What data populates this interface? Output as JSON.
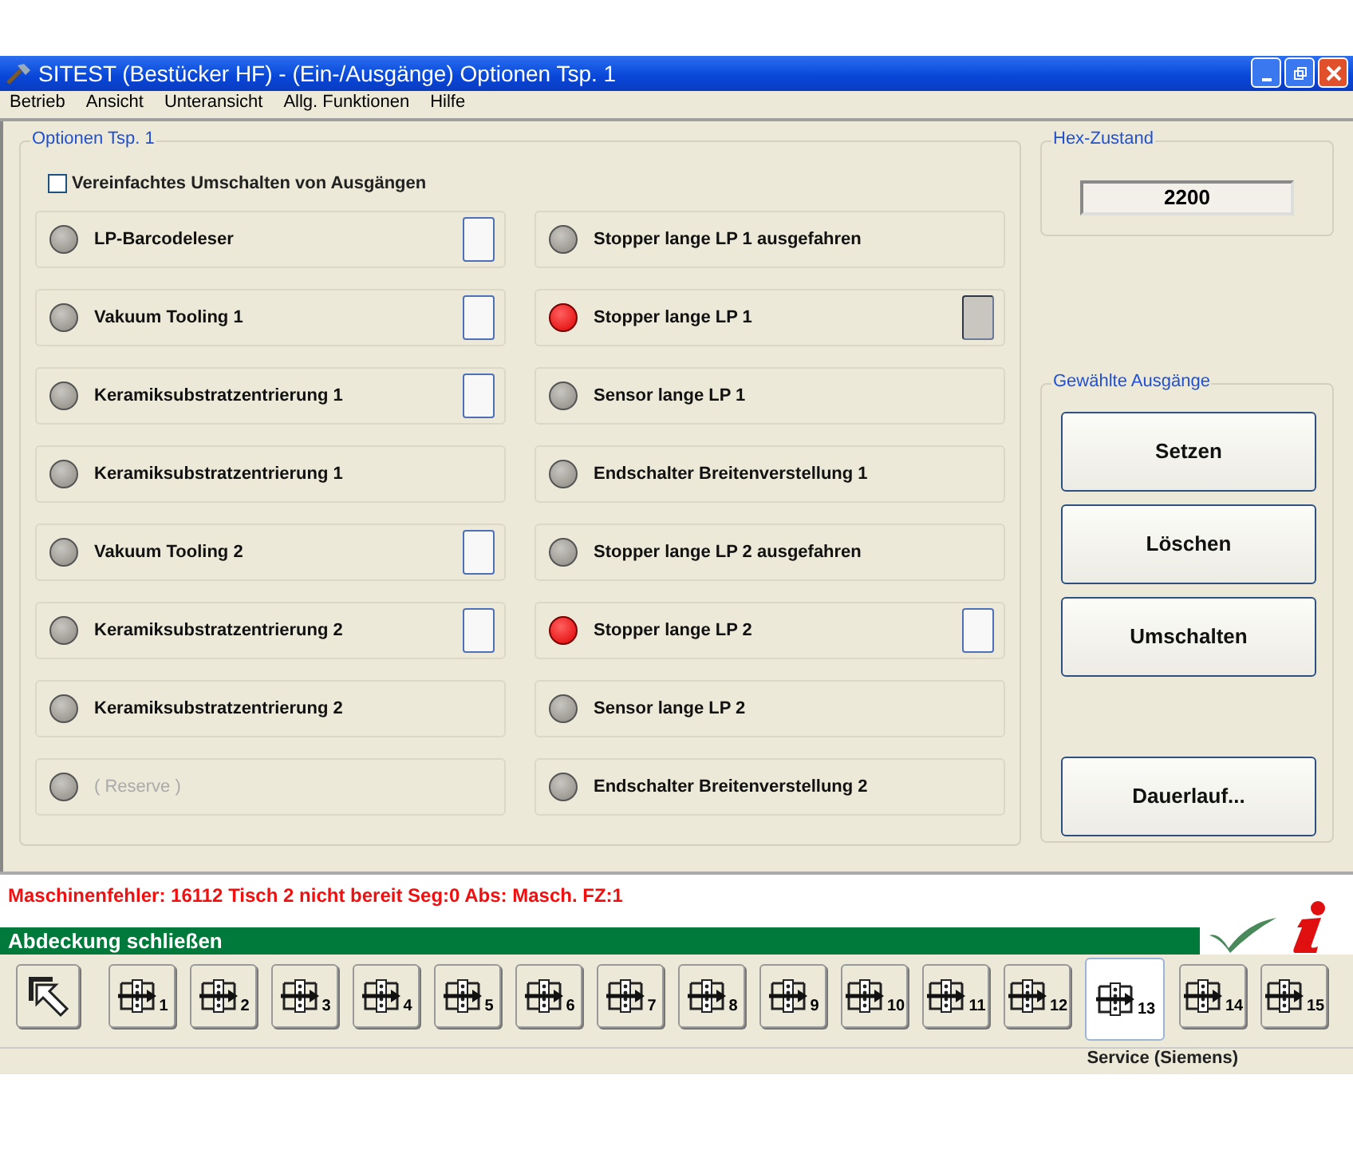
{
  "window": {
    "title": "SITEST (Bestücker HF) - (Ein-/Ausgänge) Optionen Tsp. 1"
  },
  "menu": [
    "Betrieb",
    "Ansicht",
    "Unteransicht",
    "Allg. Funktionen",
    "Hilfe"
  ],
  "options": {
    "title": "Optionen Tsp. 1",
    "checkbox": {
      "label": "Vereinfachtes Umschalten von Ausgängen",
      "checked": false
    },
    "left": [
      {
        "kind": "output",
        "label": "LP-Barcodeleser",
        "lit": false,
        "pressed": false,
        "disabled": false
      },
      {
        "kind": "output",
        "label": "Vakuum Tooling 1",
        "lit": false,
        "pressed": false,
        "disabled": false
      },
      {
        "kind": "output",
        "label": "Keramiksubstratzentrierung 1",
        "lit": false,
        "pressed": false,
        "disabled": false
      },
      {
        "kind": "input",
        "label": "Keramiksubstratzentrierung 1",
        "lit": false,
        "disabled": false
      },
      {
        "kind": "output",
        "label": "Vakuum Tooling 2",
        "lit": false,
        "pressed": false,
        "disabled": false
      },
      {
        "kind": "output",
        "label": "Keramiksubstratzentrierung 2",
        "lit": false,
        "pressed": false,
        "disabled": false
      },
      {
        "kind": "input",
        "label": "Keramiksubstratzentrierung 2",
        "lit": false,
        "disabled": false
      },
      {
        "kind": "input",
        "label": "( Reserve )",
        "lit": false,
        "disabled": true
      }
    ],
    "right": [
      {
        "kind": "input",
        "label": "Stopper lange LP 1 ausgefahren",
        "lit": false,
        "disabled": false
      },
      {
        "kind": "output",
        "label": "Stopper lange LP 1",
        "lit": true,
        "pressed": true,
        "disabled": false
      },
      {
        "kind": "input",
        "label": "Sensor lange LP 1",
        "lit": false,
        "disabled": false
      },
      {
        "kind": "input",
        "label": "Endschalter Breitenverstellung 1",
        "lit": false,
        "disabled": false
      },
      {
        "kind": "input",
        "label": "Stopper lange LP 2 ausgefahren",
        "lit": false,
        "disabled": false
      },
      {
        "kind": "output",
        "label": "Stopper lange LP 2",
        "lit": true,
        "pressed": false,
        "disabled": false
      },
      {
        "kind": "input",
        "label": "Sensor lange LP 2",
        "lit": false,
        "disabled": false
      },
      {
        "kind": "input",
        "label": "Endschalter Breitenverstellung 2",
        "lit": false,
        "disabled": false
      }
    ]
  },
  "hex": {
    "title": "Hex-Zustand",
    "value": "2200"
  },
  "outputs": {
    "title": "Gewählte Ausgänge",
    "buttons": [
      "Setzen",
      "Löschen",
      "Umschalten"
    ],
    "extra_button": "Dauerlauf..."
  },
  "error_line": "Maschinenfehler: 16112  Tisch 2 nicht bereit  Seg:0  Abs: Masch.  FZ:1",
  "message_bar": "Abdeckung schließen",
  "toolbar": [
    {
      "kind": "pointer",
      "selected": false
    },
    {
      "kind": "station",
      "number": "1",
      "selected": false
    },
    {
      "kind": "station",
      "number": "2",
      "selected": false
    },
    {
      "kind": "station",
      "number": "3",
      "selected": false
    },
    {
      "kind": "station",
      "number": "4",
      "selected": false
    },
    {
      "kind": "station",
      "number": "5",
      "selected": false
    },
    {
      "kind": "station",
      "number": "6",
      "selected": false
    },
    {
      "kind": "station",
      "number": "7",
      "selected": false
    },
    {
      "kind": "station",
      "number": "8",
      "selected": false
    },
    {
      "kind": "station",
      "number": "9",
      "selected": false
    },
    {
      "kind": "station",
      "number": "10",
      "selected": false
    },
    {
      "kind": "station",
      "number": "11",
      "selected": false
    },
    {
      "kind": "station",
      "number": "12",
      "selected": false
    },
    {
      "kind": "station",
      "number": "13",
      "selected": true
    },
    {
      "kind": "station",
      "number": "14",
      "selected": false
    },
    {
      "kind": "station",
      "number": "15",
      "selected": false
    }
  ],
  "status_bar": "Service (Siemens)"
}
